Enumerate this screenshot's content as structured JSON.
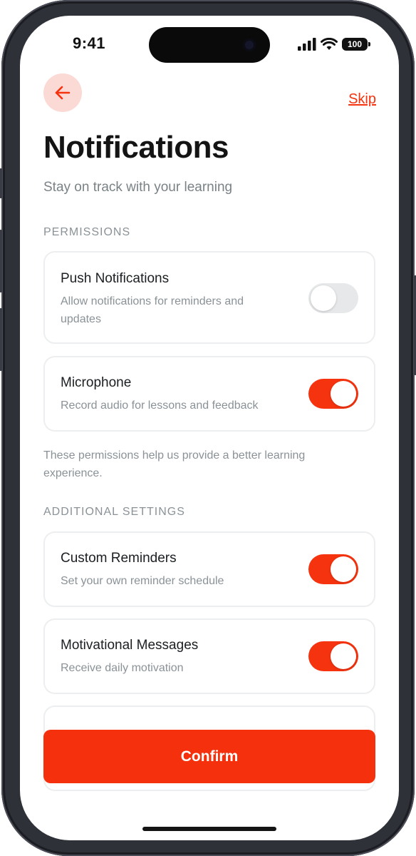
{
  "status_bar": {
    "time": "9:41",
    "battery": "100"
  },
  "header": {
    "skip_label": "Skip",
    "title": "Notifications",
    "subtitle": "Stay on track with your learning"
  },
  "permissions": {
    "section_label": "PERMISSIONS",
    "items": [
      {
        "title": "Push Notifications",
        "desc_line1": "Allow notifications for reminders and",
        "desc_line2": "updates",
        "enabled": false
      },
      {
        "title": "Microphone",
        "desc_line1": "Record audio for lessons and feedback",
        "desc_line2": "",
        "enabled": true
      }
    ],
    "note_line1": "These permissions help us provide a better learning",
    "note_line2": "experience."
  },
  "additional": {
    "section_label": "ADDITIONAL SETTINGS",
    "items": [
      {
        "title": "Custom Reminders",
        "desc": "Set your own reminder schedule",
        "enabled": true
      },
      {
        "title": "Motivational Messages",
        "desc": "Receive daily motivation",
        "enabled": true
      }
    ]
  },
  "footer": {
    "confirm_label": "Confirm"
  },
  "colors": {
    "accent": "#f5330f",
    "toggle_off": "#e6e8ea",
    "back_bg": "#fbd9d5"
  }
}
